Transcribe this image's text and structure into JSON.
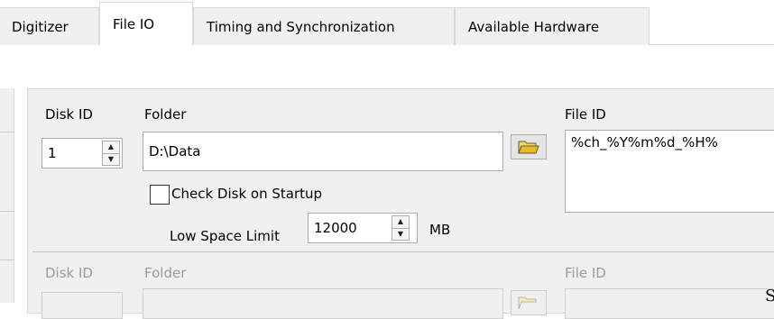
{
  "tabs": [
    {
      "label": "Digitizer",
      "active": false
    },
    {
      "label": "File IO",
      "active": true
    },
    {
      "label": "Timing and Synchronization",
      "active": false
    },
    {
      "label": "Available Hardware",
      "active": false
    }
  ],
  "rows": [
    {
      "disk_id_label": "Disk ID",
      "disk_id_value": "1",
      "folder_label": "Folder",
      "folder_value": "D:\\Data",
      "check_disk_label": "Check Disk on Startup",
      "check_disk_checked": false,
      "low_space_label": "Low Space Limit",
      "low_space_value": "12000",
      "low_space_unit": "MB",
      "file_id_label": "File ID",
      "file_id_value": "%ch_%Y%m%d_%H%"
    },
    {
      "disk_id_label": "Disk ID",
      "folder_label": "Folder",
      "file_id_label": "File ID",
      "disabled": true
    }
  ],
  "right_edge_glyph": "S",
  "icons": {
    "browse": "folder-open-icon",
    "spin_up": "arrow-up-icon",
    "spin_down": "arrow-down-icon"
  }
}
